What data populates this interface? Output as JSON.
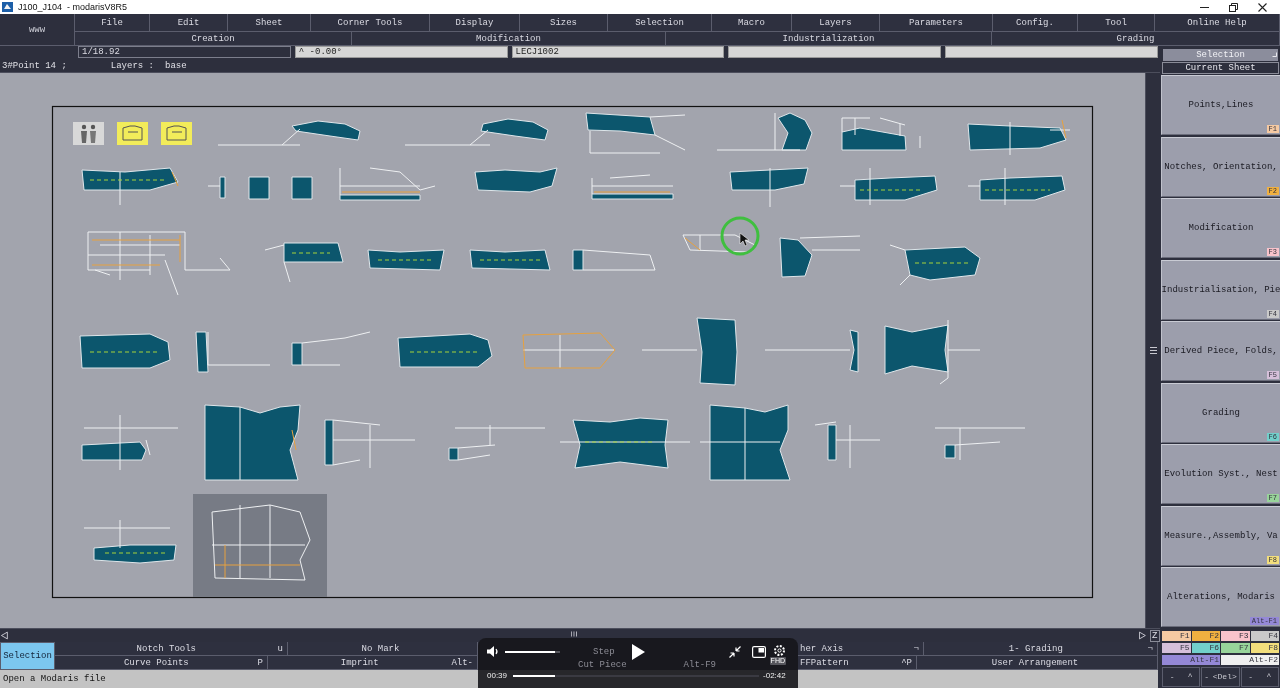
{
  "window": {
    "title": "J100_J104  - modarisV8R5"
  },
  "menu_bar": {
    "logo": "www",
    "items": [
      "File",
      "Edit",
      "Sheet",
      "Corner Tools",
      "Display",
      "Sizes",
      "Selection",
      "Macro",
      "Layers",
      "Parameters",
      "Config.",
      "Tool",
      "Online Help"
    ]
  },
  "function_groups": [
    "Creation",
    "Modification",
    "Industrialization",
    "Grading"
  ],
  "value_fields": [
    {
      "kind": "dark",
      "value": "1/18.92"
    },
    {
      "kind": "light",
      "value": "^ -0.00°"
    },
    {
      "kind": "light",
      "value": "LECJ1002"
    },
    {
      "kind": "light"
    },
    {
      "kind": "light"
    }
  ],
  "info_bar": {
    "point": "3#Point 14 ;",
    "layers_label": "Layers :",
    "layers_value": "base"
  },
  "scrollbar": {
    "zoom_label": "Z"
  },
  "tool_bar": {
    "mode_button": {
      "label": "Selection",
      "selected": true
    },
    "rows": [
      [
        {
          "kind": "button",
          "label": "Notch Tools",
          "shortcut": "u"
        },
        {
          "kind": "button",
          "label": "No Mark"
        },
        {
          "kind": "dimmed",
          "label": "Step"
        },
        {
          "kind": "button",
          "label": "her Axis",
          "shortcut": "¬"
        },
        {
          "kind": "button",
          "label": "1- Grading",
          "shortcut": "¬"
        }
      ],
      [
        {
          "kind": "button",
          "label": "Curve Points",
          "shortcut": "P"
        },
        {
          "kind": "button",
          "label": "Imprint",
          "shortcut": "Alt-"
        },
        {
          "kind": "dimmed",
          "label": "Cut Piece",
          "shortcut": "Alt-F9"
        },
        {
          "kind": "button",
          "label": "FFPattern",
          "shortcut": "^P"
        },
        {
          "kind": "button",
          "label": "User Arrangement"
        }
      ]
    ]
  },
  "status_bar": {
    "text": "Open a Modaris file"
  },
  "video_player": {
    "volume": {
      "level": 0.9
    },
    "current_time": "00:39",
    "progress": {
      "level": 0.17
    },
    "remaining_time": "-02:42",
    "quality_badge": "FHD"
  },
  "side_panel": {
    "selection_button": "Selection",
    "sheet_label": "Current Sheet",
    "buttons": [
      {
        "label": "Points,Lines",
        "key": "F1",
        "color": "#f5c9a2"
      },
      {
        "label": "Notches, Orientation,",
        "key": "F2",
        "color": "#f0b040"
      },
      {
        "label": "Modification",
        "key": "F3",
        "color": "#f9c3cb"
      },
      {
        "label": "Industrialisation, Pie",
        "key": "F4",
        "color": "#c9c9c9"
      },
      {
        "label": "Derived Piece, Folds,",
        "key": "F5",
        "color": "#d5bfd9"
      },
      {
        "label": "Grading",
        "key": "F6",
        "color": "#72d0cb"
      },
      {
        "label": "Evolution Syst., Nest",
        "key": "F7",
        "color": "#98d49a"
      },
      {
        "label": "Measure.,Assembly, Va",
        "key": "F8",
        "color": "#f2de7c"
      },
      {
        "label": "Alterations, Modaris",
        "key": "Alt-F1",
        "color": "#9488d6"
      }
    ],
    "key_swatches": [
      {
        "key": "F1",
        "color": "#f5c9a2"
      },
      {
        "key": "F2",
        "color": "#f0b040"
      },
      {
        "key": "F3",
        "color": "#f9c3cb"
      },
      {
        "key": "F4",
        "color": "#c9c9c9"
      },
      {
        "key": "F5",
        "color": "#d5bfd9"
      },
      {
        "key": "F6",
        "color": "#72d0cb"
      },
      {
        "key": "F7",
        "color": "#98d49a"
      },
      {
        "key": "F8",
        "color": "#f2de7c"
      },
      {
        "key": "Alt-F1",
        "color": "#9488d6"
      },
      {
        "key": "Alt-F2",
        "color": "#efefef"
      }
    ],
    "extra_keys": [
      {
        "label": "-",
        "key": "^"
      },
      {
        "label": "-",
        "key": "<Del>"
      },
      {
        "label": "-",
        "key": "^"
      }
    ]
  }
}
